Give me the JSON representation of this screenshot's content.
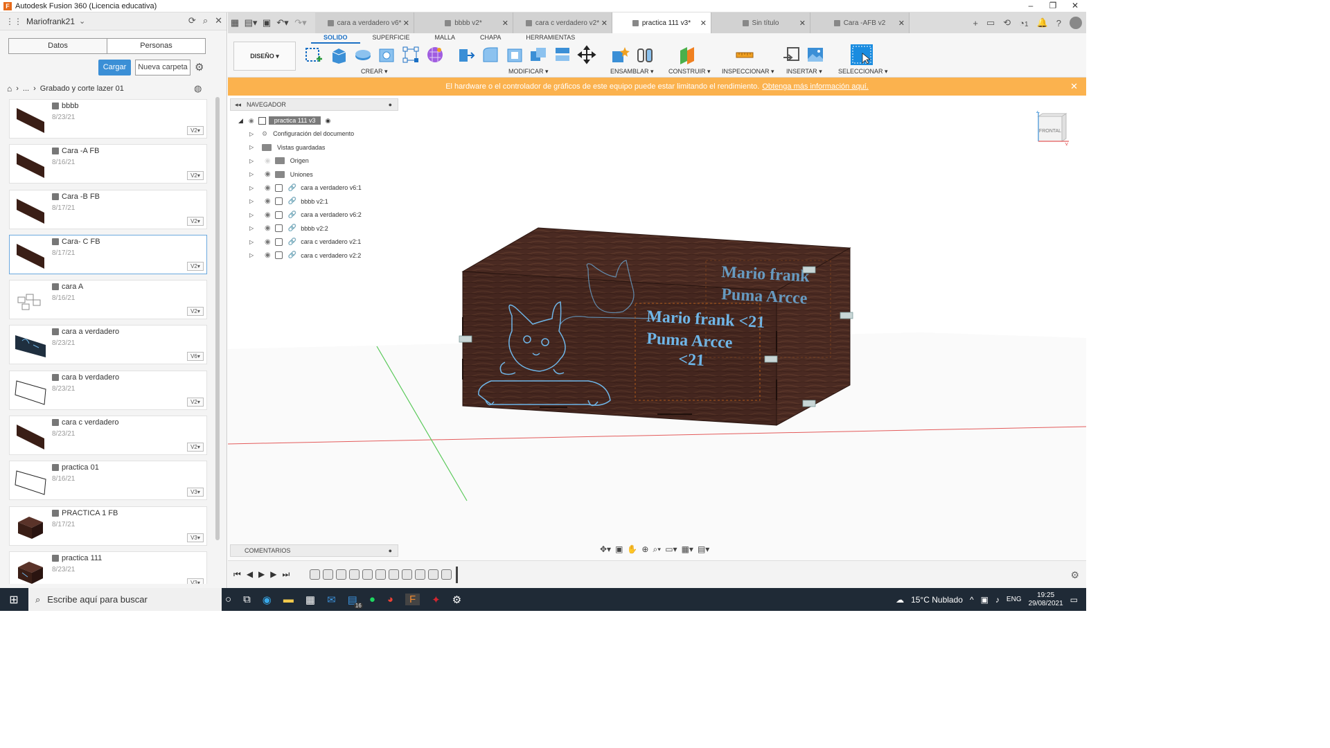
{
  "app": {
    "title": "Autodesk Fusion 360 (Licencia educativa)",
    "logo": "F"
  },
  "left_panel": {
    "user": "Mariofrank21",
    "tabs": [
      "Datos",
      "Personas"
    ],
    "upload_label": "Cargar",
    "new_folder_label": "Nueva carpeta",
    "breadcrumb_ellipsis": "...",
    "breadcrumb_folder": "Grabado y corte lazer 01",
    "files": [
      {
        "name": "bbbb",
        "date": "8/23/21",
        "version": "V2"
      },
      {
        "name": "Cara -A FB",
        "date": "8/16/21",
        "version": "V2"
      },
      {
        "name": "Cara -B FB",
        "date": "8/17/21",
        "version": "V2"
      },
      {
        "name": "Cara- C FB",
        "date": "8/17/21",
        "version": "V2"
      },
      {
        "name": "cara A",
        "date": "8/16/21",
        "version": "V2"
      },
      {
        "name": "cara a verdadero",
        "date": "8/23/21",
        "version": "V6"
      },
      {
        "name": "cara b verdadero",
        "date": "8/23/21",
        "version": "V2"
      },
      {
        "name": "cara c verdadero",
        "date": "8/23/21",
        "version": "V2"
      },
      {
        "name": "practica 01",
        "date": "8/16/21",
        "version": "V3"
      },
      {
        "name": "PRACTICA 1 FB",
        "date": "8/17/21",
        "version": "V3"
      },
      {
        "name": "practica 111",
        "date": "8/23/21",
        "version": "V3"
      }
    ]
  },
  "doc_tabs": [
    {
      "label": "cara a verdadero v6*"
    },
    {
      "label": "bbbb v2*"
    },
    {
      "label": "cara c verdadero v2*"
    },
    {
      "label": "practica 111 v3*",
      "active": true
    },
    {
      "label": "Sin título"
    },
    {
      "label": "Cara -AFB v2"
    }
  ],
  "topright_badge": "1",
  "toolbar": {
    "workspace": "DISEÑO",
    "ws_tabs": [
      "SOLIDO",
      "SUPERFICIE",
      "MALLA",
      "CHAPA",
      "HERRAMIENTAS"
    ],
    "groups": [
      "CREAR",
      "MODIFICAR",
      "ENSAMBLAR",
      "CONSTRUIR",
      "INSPECCIONAR",
      "INSERTAR",
      "SELECCIONAR"
    ]
  },
  "warning": {
    "text": "El hardware o el controlador de gráficos de este equipo puede estar limitando el rendimiento.",
    "link": "Obtenga más información aquí."
  },
  "navigator": {
    "title": "NAVEGADOR",
    "root": "practica 111 v3",
    "items": [
      {
        "label": "Configuración del documento",
        "kind": "gear"
      },
      {
        "label": "Vistas guardadas",
        "kind": "folder"
      },
      {
        "label": "Origen",
        "kind": "folder-eye"
      },
      {
        "label": "Uniones",
        "kind": "folder-eye"
      },
      {
        "label": "cara a verdadero v6:1",
        "kind": "comp"
      },
      {
        "label": "bbbb v2:1",
        "kind": "comp"
      },
      {
        "label": "cara a verdadero v6:2",
        "kind": "comp"
      },
      {
        "label": "bbbb v2:2",
        "kind": "comp"
      },
      {
        "label": "cara c verdadero v2:1",
        "kind": "comp"
      },
      {
        "label": "cara c verdadero v2:2",
        "kind": "comp"
      }
    ]
  },
  "viewcube": {
    "face": "FRONTAL",
    "z": "Z",
    "x": "X"
  },
  "engraving": {
    "line1": "Mario frank <21",
    "line2": "Puma Arcce",
    "line3": "<21",
    "back1": "Mario frank",
    "back2": "Puma Arcce"
  },
  "comments_label": "COMENTARIOS",
  "taskbar": {
    "search_placeholder": "Escribe aquí para buscar",
    "weather": "15°C  Nublado",
    "lang": "ENG",
    "time": "19:25",
    "date": "29/08/2021",
    "badge": "16"
  }
}
